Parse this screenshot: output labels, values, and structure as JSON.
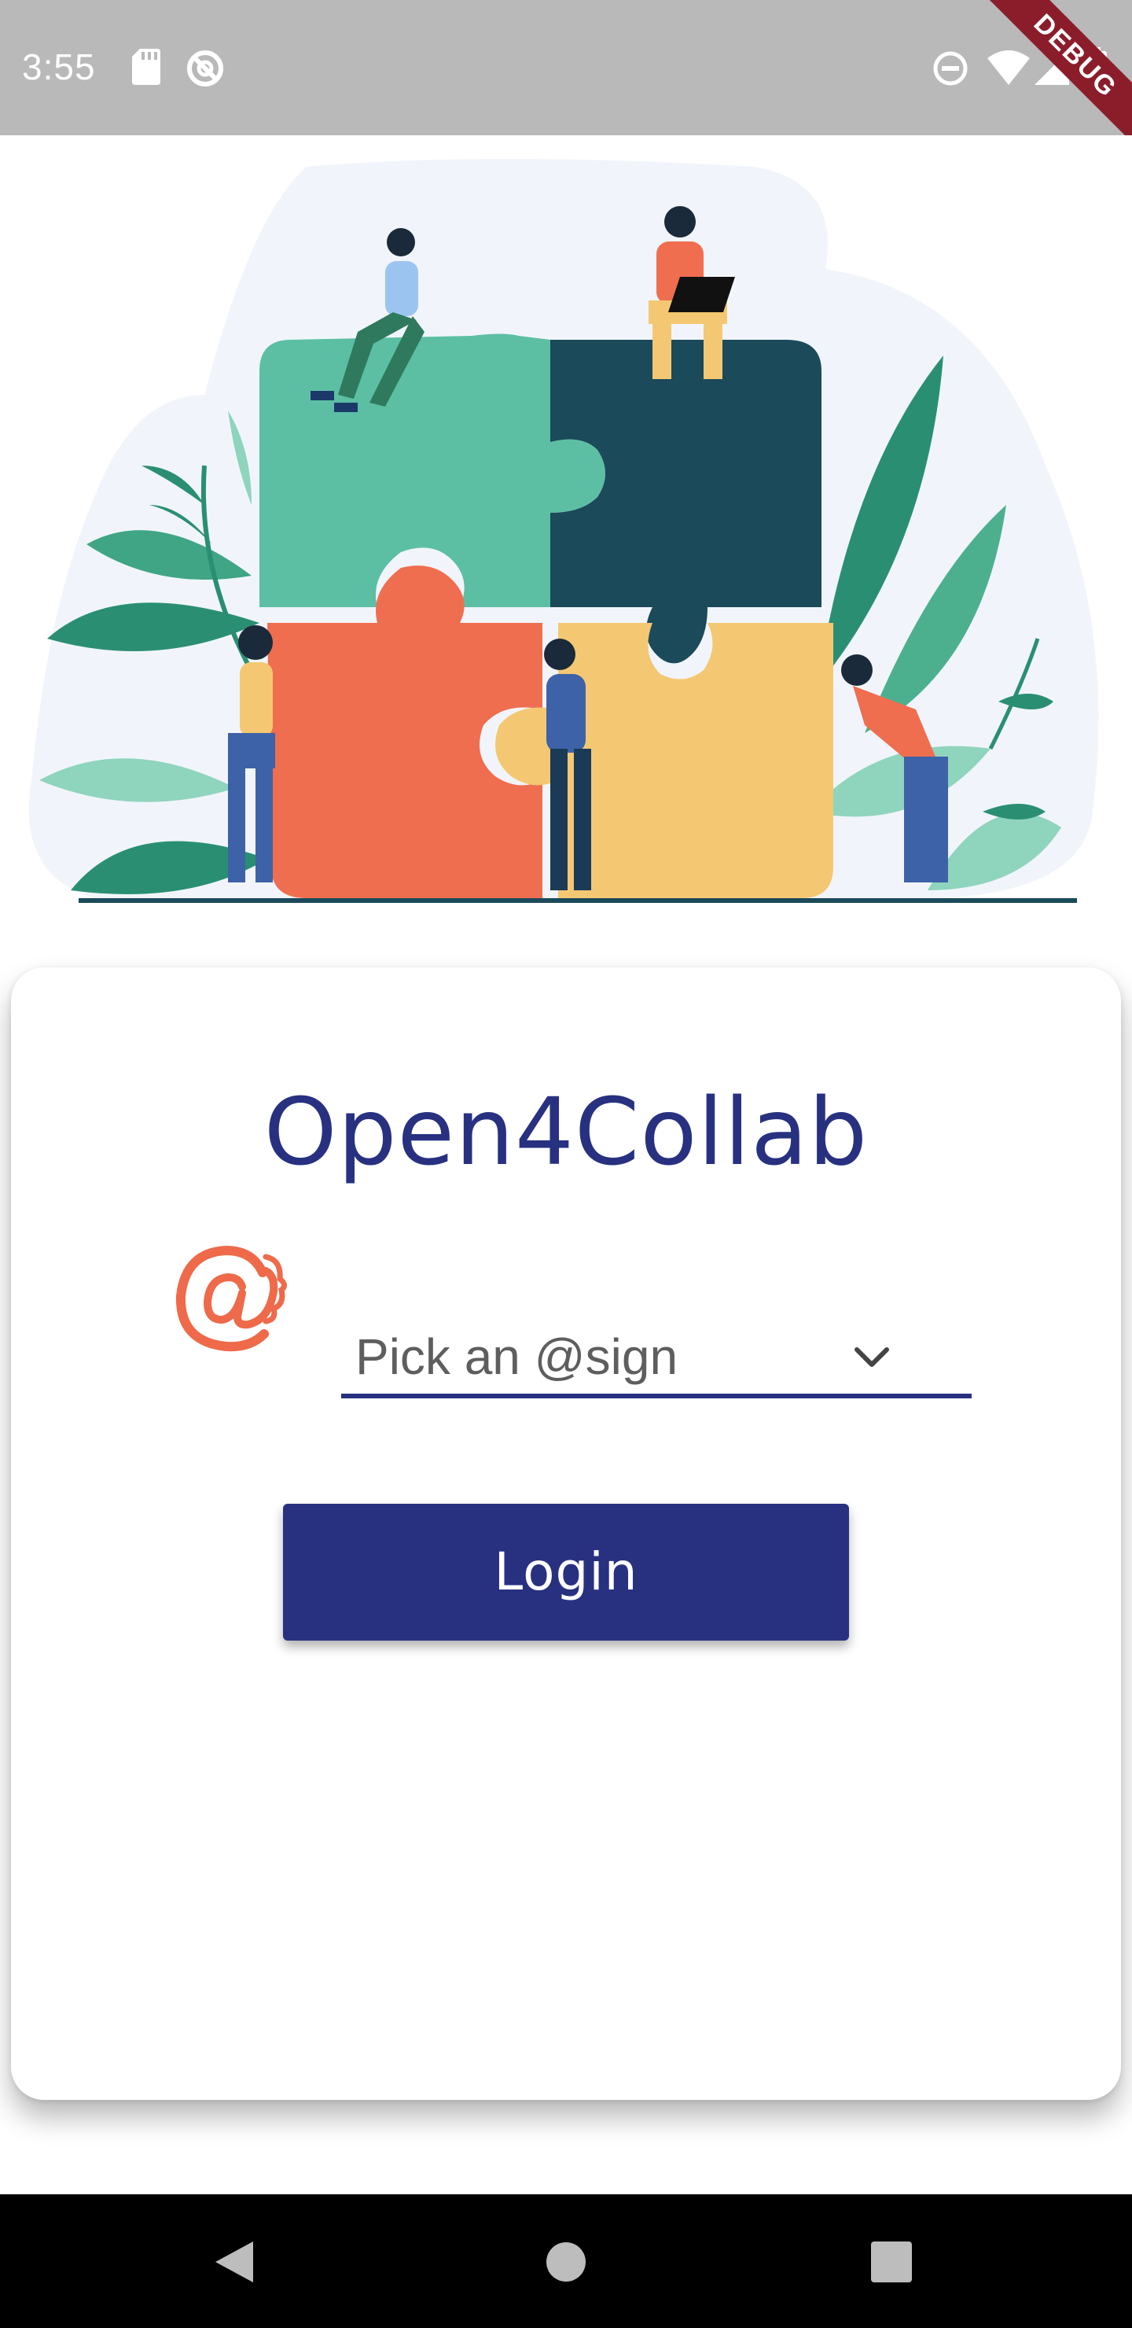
{
  "status_bar": {
    "time": "3:55",
    "left_icons": [
      "sd-card-icon",
      "sync-disabled-icon"
    ],
    "right_icons": [
      "do-not-disturb-icon",
      "wifi-icon",
      "signal-icon",
      "battery-icon"
    ],
    "debug_banner": "DEBUG"
  },
  "hero": {
    "illustration": "team-puzzle-illustration"
  },
  "login_card": {
    "title": "Open4Collab",
    "atsign_logo": "atsign-logo-icon",
    "dropdown": {
      "selected_value": "Pick an @sign",
      "icon": "chevron-down-icon"
    },
    "login_button_label": "Login"
  },
  "nav_bar": {
    "buttons": [
      "back-icon",
      "home-icon",
      "recents-icon"
    ]
  },
  "colors": {
    "primary": "#283180",
    "accent_orange": "#ee6a4a",
    "status_bar": "#b9b9b9",
    "debug_ribbon": "#8b1d2b"
  }
}
